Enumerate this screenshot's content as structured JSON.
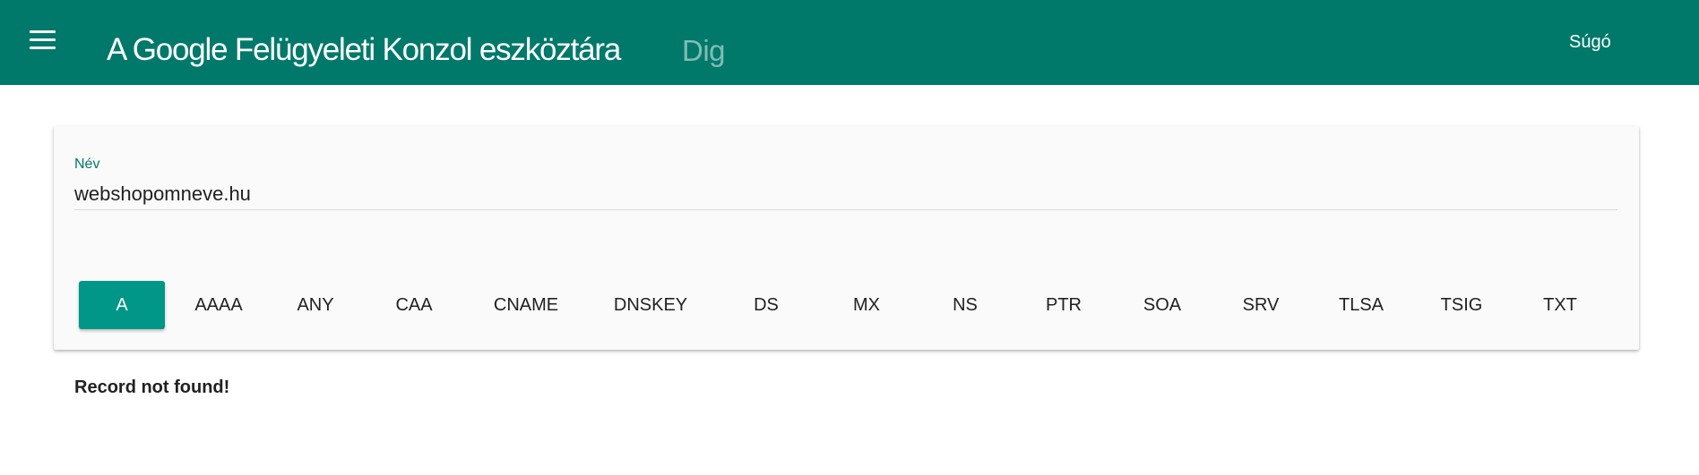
{
  "header": {
    "title": "A Google Felügyeleti Konzol eszköztára",
    "subtitle": "Dig",
    "help_label": "Súgó",
    "menu_icon": "menu-icon",
    "color": "#00796b"
  },
  "query": {
    "name_label": "Név",
    "name_value": "webshopomneve.hu"
  },
  "record_types": {
    "selected": "A",
    "items": [
      "A",
      "AAAA",
      "ANY",
      "CAA",
      "CNAME",
      "DNSKEY",
      "DS",
      "MX",
      "NS",
      "PTR",
      "SOA",
      "SRV",
      "TLSA",
      "TSIG",
      "TXT"
    ],
    "active_color": "#009688"
  },
  "result": {
    "message": "Record not found!"
  }
}
